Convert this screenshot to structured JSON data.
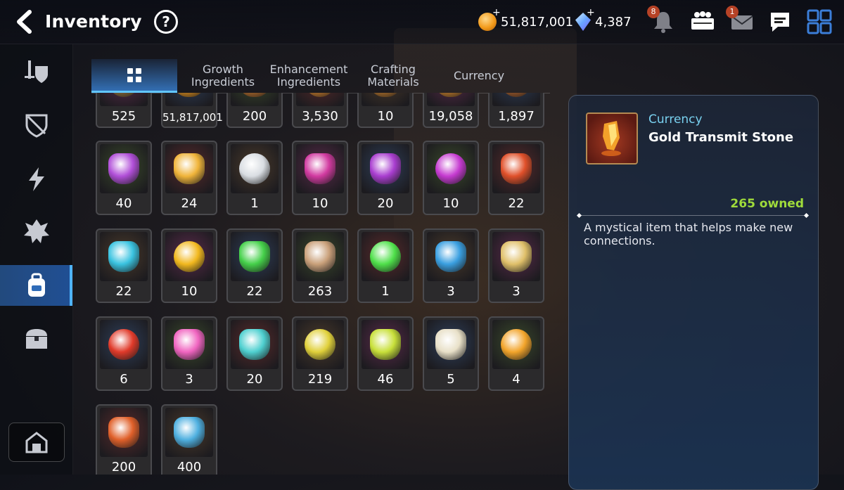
{
  "header": {
    "title": "Inventory",
    "help_label": "?",
    "gold": "51,817,001",
    "crystals": "4,387",
    "notifications_badge": "8",
    "mail_badge": "1"
  },
  "sidebar": {
    "items": [
      {
        "name": "equipment",
        "icon": "sword-shield-icon"
      },
      {
        "name": "artifact",
        "icon": "shield-icon"
      },
      {
        "name": "catalyst",
        "icon": "lightning-icon"
      },
      {
        "name": "memory",
        "icon": "monster-icon"
      },
      {
        "name": "materials",
        "icon": "backpack-icon",
        "active": true
      },
      {
        "name": "chests",
        "icon": "chest-icon"
      }
    ],
    "bottom": {
      "icon": "house-icon"
    }
  },
  "tabs": [
    {
      "label": "",
      "icon": "grid-icon",
      "active": true
    },
    {
      "label": "Growth Ingredients"
    },
    {
      "label": "Enhancement Ingredients"
    },
    {
      "label": "Crafting Materials"
    },
    {
      "label": "Currency"
    }
  ],
  "items": [
    {
      "qty": "525",
      "color": "#8a6a3a"
    },
    {
      "qty": "51,817,001",
      "color": "#d68a1e"
    },
    {
      "qty": "200",
      "color": "#b06a2a"
    },
    {
      "qty": "3,530",
      "color": "#c0762a"
    },
    {
      "qty": "10",
      "color": "#b0702a"
    },
    {
      "qty": "19,058",
      "color": "#c07a2a"
    },
    {
      "qty": "1,897",
      "color": "#a05a2a"
    },
    {
      "qty": "40",
      "color": "#b14fd8"
    },
    {
      "qty": "24",
      "color": "#f0b43a"
    },
    {
      "qty": "1",
      "color": "#d9dde2"
    },
    {
      "qty": "10",
      "color": "#d13aa0"
    },
    {
      "qty": "20",
      "color": "#a93ed0"
    },
    {
      "qty": "10",
      "color": "#c53ad0"
    },
    {
      "qty": "22",
      "color": "#e0502a"
    },
    {
      "qty": "22",
      "color": "#3ac3e0"
    },
    {
      "qty": "10",
      "color": "#f2b81e"
    },
    {
      "qty": "22",
      "color": "#45d04a"
    },
    {
      "qty": "263",
      "color": "#c9a07a"
    },
    {
      "qty": "1",
      "color": "#4fe04a"
    },
    {
      "qty": "3",
      "color": "#3a9fe0"
    },
    {
      "qty": "3",
      "color": "#e0c06a"
    },
    {
      "qty": "6",
      "color": "#e03a2a"
    },
    {
      "qty": "3",
      "color": "#f065c0"
    },
    {
      "qty": "20",
      "color": "#4fd0d0"
    },
    {
      "qty": "219",
      "color": "#e0d03a"
    },
    {
      "qty": "46",
      "color": "#c8e03a"
    },
    {
      "qty": "5",
      "color": "#e8e0c8"
    },
    {
      "qty": "4",
      "color": "#f2a42a"
    },
    {
      "qty": "200",
      "color": "#e0602a"
    },
    {
      "qty": "400",
      "color": "#4fb0e0"
    }
  ],
  "detail": {
    "category": "Currency",
    "name": "Gold Transmit Stone",
    "owned": "265 owned",
    "description": "A mystical item that helps make new connections."
  }
}
